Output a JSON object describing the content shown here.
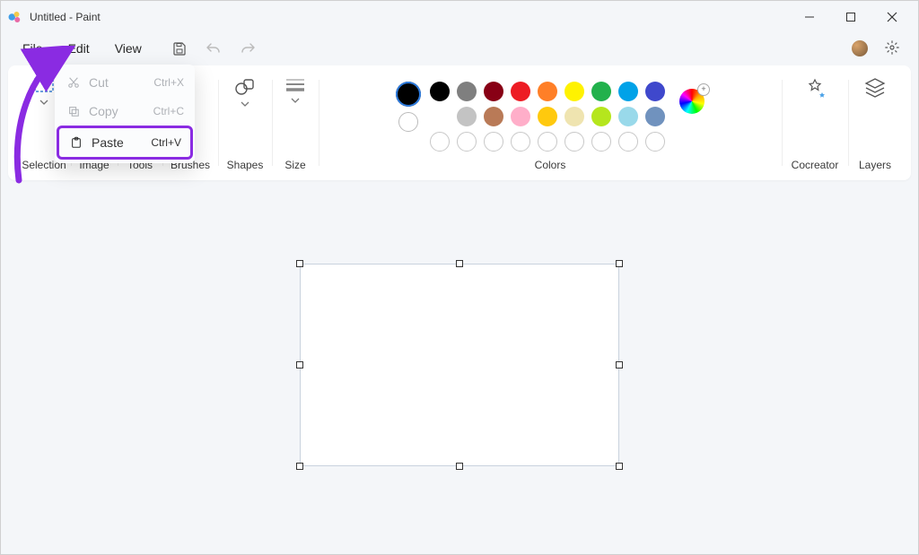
{
  "titlebar": {
    "title": "Untitled - Paint"
  },
  "menubar": {
    "file": "File",
    "edit": "Edit",
    "view": "View"
  },
  "editMenu": {
    "cut": {
      "label": "Cut",
      "shortcut": "Ctrl+X"
    },
    "copy": {
      "label": "Copy",
      "shortcut": "Ctrl+C"
    },
    "paste": {
      "label": "Paste",
      "shortcut": "Ctrl+V"
    }
  },
  "ribbon": {
    "selection": "Selection",
    "image": "Image",
    "tools": "Tools",
    "brushes": "Brushes",
    "shapes": "Shapes",
    "size": "Size",
    "colors": "Colors",
    "cocreator": "Cocreator",
    "layers": "Layers"
  },
  "colors": {
    "primary": "#000000",
    "secondary": "#ffffff",
    "palette_row1": [
      "#000000",
      "#7f7f7f",
      "#880015",
      "#ed1c24",
      "#ff7f27",
      "#fff200",
      "#22b14c",
      "#00a2e8",
      "#3f48cc",
      "#a349a4"
    ],
    "palette_row2": [
      "#ffffff",
      "#c3c3c3",
      "#b97a57",
      "#ffaec9",
      "#ffc90e",
      "#efe4b0",
      "#b5e61d",
      "#99d9ea",
      "#7092be",
      "#c8bfe7"
    ]
  }
}
